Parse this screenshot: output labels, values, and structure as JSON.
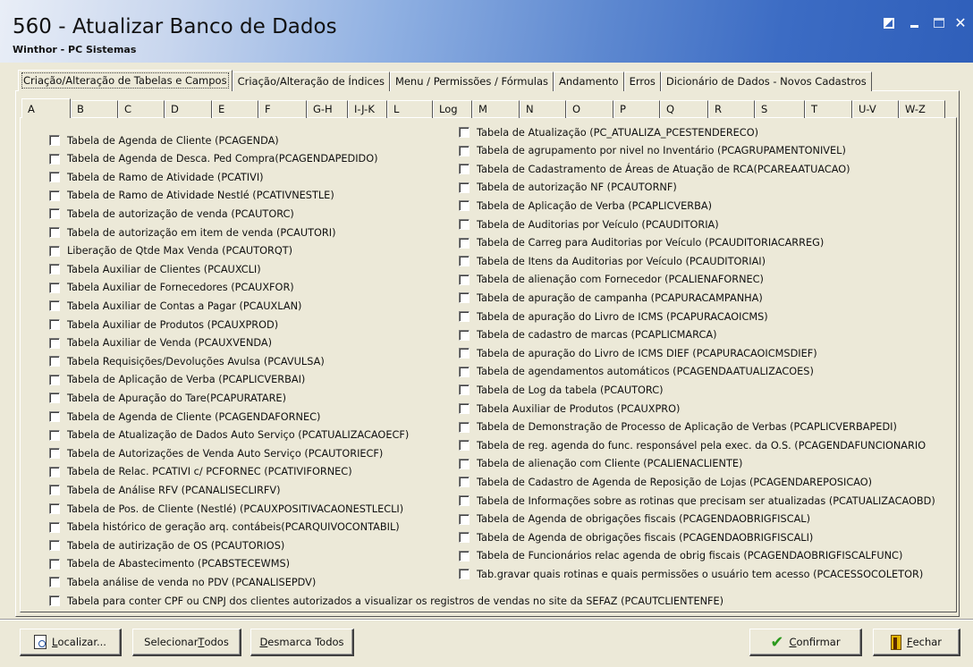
{
  "window": {
    "title": "560 - Atualizar Banco de Dados",
    "subtitle": "Winthor - PC Sistemas"
  },
  "main_tabs": [
    {
      "label": "Criação/Alteração de Tabelas e Campos",
      "active": true
    },
    {
      "label": "Criação/Alteração de Índices"
    },
    {
      "label": "Menu / Permissões / Fórmulas"
    },
    {
      "label": "Andamento"
    },
    {
      "label": "Erros"
    },
    {
      "label": "Dicionário de Dados - Novos Cadastros"
    }
  ],
  "letter_tabs": [
    "A",
    "B",
    "C",
    "D",
    "E",
    "F",
    "G-H",
    "I-J-K",
    "L",
    "Log",
    "M",
    "N",
    "O",
    "P",
    "Q",
    "R",
    "S",
    "T",
    "U-V",
    "W-Z"
  ],
  "left_items": [
    "Tabela  de Agenda de Cliente (PCAGENDA)",
    "Tabela  de Agenda de Desca. Ped Compra(PCAGENDAPEDIDO)",
    "Tabela de Ramo de Atividade (PCATIVI)",
    "Tabela de Ramo de Atividade Nestlé (PCATIVNESTLE)",
    "Tabela de autorização de venda (PCAUTORC)",
    "Tabela de autorização em item de venda (PCAUTORI)",
    "Liberação de Qtde Max Venda (PCAUTORQT)",
    "Tabela Auxiliar de Clientes (PCAUXCLI)",
    "Tabela Auxiliar de Fornecedores (PCAUXFOR)",
    "Tabela Auxiliar de Contas a Pagar (PCAUXLAN)",
    "Tabela Auxiliar de Produtos (PCAUXPROD)",
    "Tabela Auxiliar de Venda (PCAUXVENDA)",
    "Tabela Requisições/Devoluções Avulsa (PCAVULSA)",
    "Tabela de Aplicação de Verba (PCAPLICVERBAI)",
    "Tabela de Apuração do Tare(PCAPURATARE)",
    "Tabela  de Agenda de Cliente (PCAGENDAFORNEC)",
    "Tabela  de Atualização de Dados Auto Serviço (PCATUALIZACAOECF)",
    "Tabela de Autorizações de Venda Auto Serviço (PCAUTORIECF)",
    "Tabela de Relac. PCATIVI c/ PCFORNEC (PCATIVIFORNEC)",
    "Tabela de Análise RFV (PCANALISECLIRFV)",
    "Tabela de Pos. de Cliente (Nestlé) (PCAUXPOSITIVACAONESTLECLI)",
    "Tabela histórico de geração arq. contábeis(PCARQUIVOCONTABIL)",
    "Tabela de autirização de OS (PCAUTORIOS)",
    "Tabela de Abastecimento (PCABSTECEWMS)",
    "Tabela análise de venda no PDV (PCANALISEPDV)",
    "Tabela para conter CPF ou CNPJ dos clientes autorizados a visualizar os registros de vendas no site da SEFAZ (PCAUTCLIENTENFE)"
  ],
  "right_items": [
    "Tabela de Atualização (PC_ATUALIZA_PCESTENDERECO)",
    "Tabela de agrupamento por nivel no Inventário (PCAGRUPAMENTONIVEL)",
    "Tabela de Cadastramento de Áreas de Atuação de RCA(PCAREAATUACAO)",
    "Tabela de autorização NF (PCAUTORNF)",
    "Tabela de Aplicação de Verba (PCAPLICVERBA)",
    "Tabela de Auditorias por Veículo (PCAUDITORIA)",
    "Tabela de Carreg para Auditorias por Veículo (PCAUDITORIACARREG)",
    "Tabela de Itens da Auditorias por Veículo (PCAUDITORIAI)",
    "Tabela de alienação com Fornecedor (PCALIENAFORNEC)",
    "Tabela de apuração de campanha (PCAPURACAMPANHA)",
    "Tabela de apuração do Livro de ICMS (PCAPURACAOICMS)",
    "Tabela de cadastro de marcas (PCAPLICMARCA)",
    "Tabela de apuração do Livro de ICMS DIEF (PCAPURACAOICMSDIEF)",
    "Tabela de agendamentos automáticos (PCAGENDAATUALIZACOES)",
    "Tabela de Log da tabela (PCAUTORC)",
    "Tabela Auxiliar de Produtos (PCAUXPRO)",
    "Tabela de Demonstração de Processo de Aplicação de Verbas (PCAPLICVERBAPEDI)",
    "Tabela de reg. agenda do func. responsável pela exec. da O.S. (PCAGENDAFUNCIONARIO",
    "Tabela de alienação com Cliente (PCALIENACLIENTE)",
    "Tabela de Cadastro de Agenda de Reposição de Lojas (PCAGENDAREPOSICAO)",
    "Tabela de Informações sobre as rotinas que precisam ser atualizadas (PCATUALIZACAOBD)",
    "Tabela de Agenda de obrigações fiscais (PCAGENDAOBRIGFISCAL)",
    "Tabela de Agenda de obrigações fiscais (PCAGENDAOBRIGFISCALI)",
    "Tabela de Funcionários relac  agenda de obrig fiscais (PCAGENDAOBRIGFISCALFUNC)",
    "Tab.gravar quais rotinas e quais permissões o usuário tem acesso (PCACESSOCOLETOR)"
  ],
  "buttons": {
    "localizar_mnemonic": "L",
    "localizar_rest": "ocalizar...",
    "selecionar_prefix": "Selecionar ",
    "selecionar_mnemonic": "T",
    "selecionar_rest": "odos",
    "desmarca_mnemonic": "D",
    "desmarca_rest": "esmarca Todos",
    "confirmar_mnemonic": "C",
    "confirmar_rest": "onfirmar",
    "fechar_mnemonic": "F",
    "fechar_rest": "echar"
  },
  "icons": {
    "localizar": "search-document-icon",
    "confirmar": "checkmark-icon",
    "fechar": "exit-door-icon"
  }
}
